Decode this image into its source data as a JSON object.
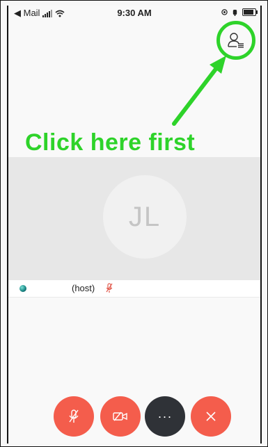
{
  "status_bar": {
    "back_app": "◀ Mail",
    "time": "9:30 AM"
  },
  "annotation": {
    "callout_text": "Click here first",
    "color": "#2ed32a"
  },
  "meeting": {
    "avatar_initials": "JL",
    "host_label": "(host)"
  },
  "colors": {
    "control_red": "#f45d4c",
    "control_dark": "#2f3237",
    "muted_red": "#e25b4e"
  },
  "icons": {
    "participants": "participants-list-icon",
    "mute": "microphone-muted-icon",
    "video": "video-off-icon",
    "more": "more-dots-icon",
    "leave": "close-icon"
  }
}
